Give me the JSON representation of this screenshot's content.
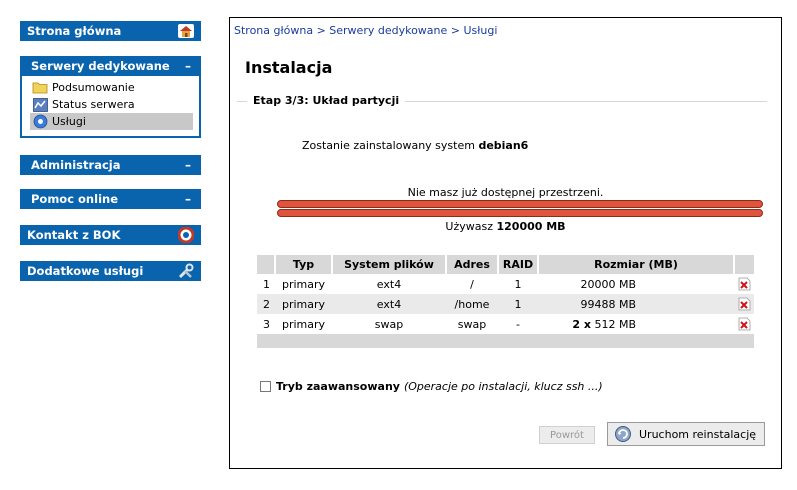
{
  "sidebar": {
    "home": {
      "label": "Strona główna",
      "icon": "home-icon"
    },
    "dedicated": {
      "label": "Serwery dedykowane",
      "toggle": "–",
      "items": [
        {
          "label": "Podsumowanie",
          "icon": "folder-icon"
        },
        {
          "label": "Status serwera",
          "icon": "status-icon"
        },
        {
          "label": "Usługi",
          "icon": "services-icon",
          "active": true
        }
      ]
    },
    "admin": {
      "label": "Administracja",
      "toggle": "–"
    },
    "help": {
      "label": "Pomoc online",
      "toggle": "–"
    },
    "contact": {
      "label": "Kontakt z BOK",
      "icon": "lifebuoy-icon"
    },
    "extra": {
      "label": "Dodatkowe usługi",
      "icon": "tools-icon"
    }
  },
  "breadcrumb": {
    "items": [
      "Strona główna",
      "Serwery dedykowane",
      "Usługi"
    ],
    "separator": ">"
  },
  "page": {
    "title": "Instalacja",
    "step": "Etap 3/3: Układ partycji",
    "install_prefix": "Zostanie zainstalowany system",
    "install_os": "debian6",
    "no_space": "Nie masz już dostępnej przestrzeni.",
    "usage_prefix": "Używasz",
    "usage_value": "120000 MB"
  },
  "table": {
    "headers": [
      "Typ",
      "System plików",
      "Adres",
      "RAID",
      "Rozmiar (MB)"
    ],
    "rows": [
      {
        "n": "1",
        "type": "primary",
        "fs": "ext4",
        "mount": "/",
        "raid": "1",
        "mult": "",
        "size": "20000 MB"
      },
      {
        "n": "2",
        "type": "primary",
        "fs": "ext4",
        "mount": "/home",
        "raid": "1",
        "mult": "",
        "size": "99488 MB"
      },
      {
        "n": "3",
        "type": "primary",
        "fs": "swap",
        "mount": "swap",
        "raid": "-",
        "mult": "2 x",
        "size": "512 MB"
      }
    ]
  },
  "advanced": {
    "label": "Tryb zaawansowany",
    "hint": "(Operacje po instalacji, klucz ssh ...)"
  },
  "buttons": {
    "back": "Powrót",
    "run": "Uruchom reinstalację"
  },
  "colors": {
    "accent": "#0a64ad",
    "bar": "#e0543e",
    "link": "#1a3c9c"
  }
}
